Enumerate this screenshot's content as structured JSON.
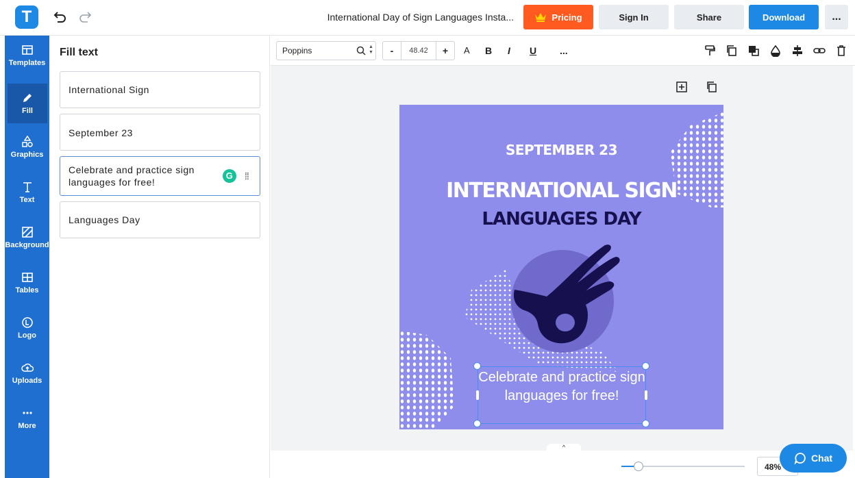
{
  "app": {
    "logo_letter": "T",
    "document_title": "International Day of Sign Languages Insta..."
  },
  "header": {
    "pricing_label": "Pricing",
    "signin_label": "Sign In",
    "share_label": "Share",
    "download_label": "Download",
    "more_label": "..."
  },
  "sidebar": {
    "items": [
      {
        "label": "Templates",
        "icon": "templates-icon"
      },
      {
        "label": "Fill",
        "icon": "pencil-icon",
        "active": true
      },
      {
        "label": "Graphics",
        "icon": "shapes-icon"
      },
      {
        "label": "Text",
        "icon": "text-icon"
      },
      {
        "label": "Background",
        "icon": "background-icon"
      },
      {
        "label": "Tables",
        "icon": "table-icon"
      },
      {
        "label": "Logo",
        "icon": "logo-icon"
      },
      {
        "label": "Uploads",
        "icon": "cloud-upload-icon"
      },
      {
        "label": "More",
        "icon": "more-dots-icon"
      }
    ]
  },
  "panel": {
    "title": "Fill text",
    "fields": [
      {
        "text": "International Sign"
      },
      {
        "text": "September 23"
      },
      {
        "text": "Celebrate and practice sign languages for free!",
        "active": true
      },
      {
        "text": "Languages Day"
      }
    ],
    "grammarly_letter": "G"
  },
  "toolbar": {
    "font_name": "Poppins",
    "font_size": "48.42",
    "minus_label": "-",
    "plus_label": "+",
    "case_label": "A",
    "bold_label": "B",
    "italic_label": "I",
    "underline_label": "U",
    "more_label": "..."
  },
  "design": {
    "date_text": "SEPTEMBER 23",
    "title_line1": "INTERNATIONAL SIGN",
    "title_line2": "LANGUAGES DAY",
    "body_text": "Celebrate and practice sign languages for free!",
    "background_color": "#8f8deb",
    "accent_dark": "#17104e",
    "circle_color": "#6f6acc"
  },
  "bottom": {
    "zoom_value": "48%",
    "zoom_fraction": 0.48,
    "chat_label": "Chat"
  },
  "colors": {
    "brand": "#1e88e5",
    "sidebar": "#1f6fd0",
    "pricing": "#ff5a1f"
  }
}
